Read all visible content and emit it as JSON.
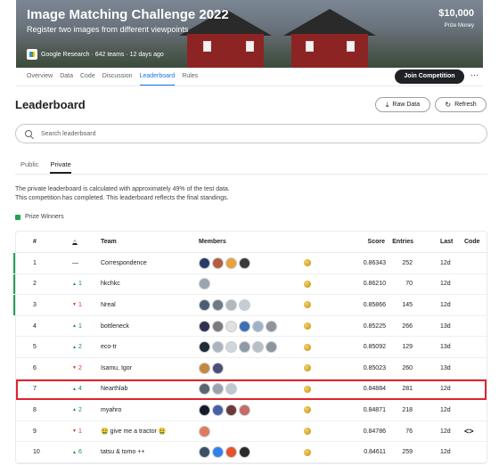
{
  "banner": {
    "title": "Image Matching Challenge 2022",
    "subtitle": "Register two images from different viewpoints",
    "host": "Google Research",
    "meta": "· 642 teams · 12 days ago",
    "prize_amount": "$10,000",
    "prize_label": "Prize Money"
  },
  "nav": {
    "tabs": [
      "Overview",
      "Data",
      "Code",
      "Discussion",
      "Leaderboard",
      "Rules"
    ],
    "active": "Leaderboard",
    "join_label": "Join Competition",
    "more_label": "···"
  },
  "leaderboard": {
    "title": "Leaderboard",
    "raw_data_label": "Raw Data",
    "refresh_label": "Refresh",
    "search_placeholder": "Search leaderboard",
    "subtabs": [
      "Public",
      "Private"
    ],
    "description_line1": "The private leaderboard is calculated with approximately 49% of the test data.",
    "description_line2": "This competition has completed. This leaderboard reflects the final standings.",
    "prize_winners_label": "Prize Winners",
    "columns": {
      "rank": "#",
      "team": "Team",
      "members": "Members",
      "score": "Score",
      "entries": "Entries",
      "last": "Last",
      "code": "Code"
    },
    "rows": [
      {
        "rank": "1",
        "delta": "—",
        "dir": "none",
        "team": "Correspondence",
        "avatars": [
          "#2b3a67",
          "#b45f3c",
          "#e9a23b",
          "#3a3a3a"
        ],
        "score": "0.86343",
        "entries": "252",
        "last": "12d",
        "prize": true
      },
      {
        "rank": "2",
        "delta": "1",
        "dir": "up",
        "team": "hkchkc",
        "avatars": [
          "#9aa5b1"
        ],
        "score": "0.86210",
        "entries": "70",
        "last": "12d",
        "prize": true
      },
      {
        "rank": "3",
        "delta": "1",
        "dir": "down",
        "team": "Nreal",
        "avatars": [
          "#4c5d73",
          "#6e7a86",
          "#b0b8c0",
          "#c5ccd3"
        ],
        "score": "0.85866",
        "entries": "145",
        "last": "12d",
        "prize": true
      },
      {
        "rank": "4",
        "delta": "1",
        "dir": "up",
        "team": "bottleneck",
        "avatars": [
          "#2f2f4f",
          "#7a7a7a",
          "#e0e0e0",
          "#3b6fb6",
          "#9fb3c8",
          "#8e949a"
        ],
        "score": "0.85225",
        "entries": "266",
        "last": "13d",
        "prize": false
      },
      {
        "rank": "5",
        "delta": "2",
        "dir": "up",
        "team": "eco-tr",
        "avatars": [
          "#1f2a37",
          "#a9b4bf",
          "#cfd6dc",
          "#8d99a6",
          "#b7c0c8",
          "#8c959e"
        ],
        "score": "0.85092",
        "entries": "129",
        "last": "13d",
        "prize": false
      },
      {
        "rank": "6",
        "delta": "2",
        "dir": "down",
        "team": "Isamu, Igor",
        "avatars": [
          "#c7863f",
          "#4b4f75"
        ],
        "score": "0.85023",
        "entries": "260",
        "last": "13d",
        "prize": false
      },
      {
        "rank": "7",
        "delta": "4",
        "dir": "up",
        "team": "Nearthlab",
        "avatars": [
          "#5b6470",
          "#9aa3ad",
          "#c0c7ce"
        ],
        "score": "0.84884",
        "entries": "281",
        "last": "12d",
        "prize": false,
        "highlight": true
      },
      {
        "rank": "8",
        "delta": "2",
        "dir": "up",
        "team": "myahro",
        "avatars": [
          "#141c2b",
          "#4b5fa8",
          "#6a3a3a",
          "#c56b6b"
        ],
        "score": "0.84871",
        "entries": "218",
        "last": "12d",
        "prize": false
      },
      {
        "rank": "9",
        "delta": "1",
        "dir": "down",
        "team": "🤮 give me a tractor 🤮",
        "avatars": [
          "#e07a5f"
        ],
        "score": "0.84786",
        "entries": "76",
        "last": "12d",
        "prize": false,
        "code": "<>"
      },
      {
        "rank": "10",
        "delta": "6",
        "dir": "up",
        "team": "tatsu & tomo ++",
        "avatars": [
          "#3c4e63",
          "#2f80ed",
          "#e6522c",
          "#2a2a2a"
        ],
        "score": "0.84611",
        "entries": "259",
        "last": "12d",
        "prize": false
      }
    ]
  }
}
